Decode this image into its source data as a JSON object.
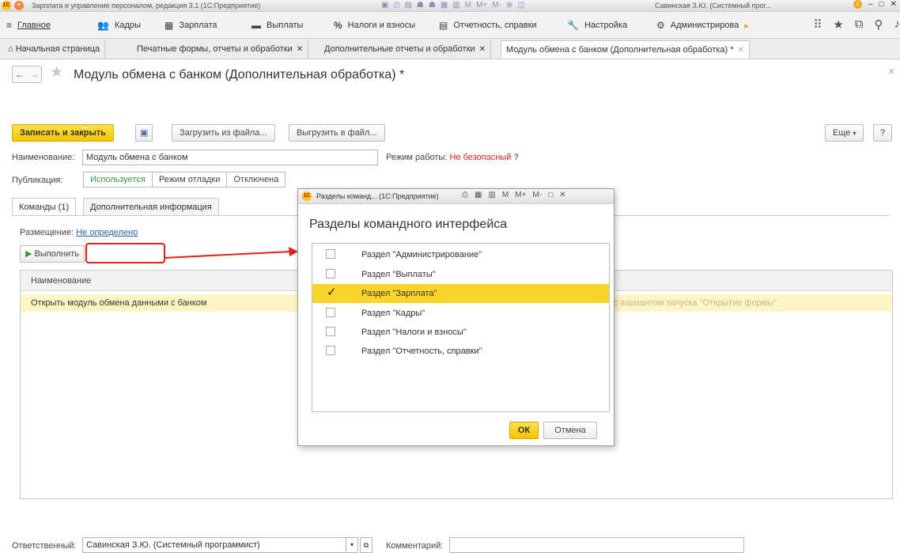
{
  "app": {
    "window_title": "Зарплата и управление персоналом, редакция 3.1  (1С:Предприятие)",
    "user": "Савинская З.Ю. (Системный прог...",
    "logo_text": "1С"
  },
  "main_menu": [
    {
      "label": "Главное",
      "icon": "≡"
    },
    {
      "label": "Кадры",
      "icon": "👥"
    },
    {
      "label": "Зарплата",
      "icon": "▦"
    },
    {
      "label": "Выплаты",
      "icon": "▬"
    },
    {
      "label": "Налоги и взносы",
      "icon": "%"
    },
    {
      "label": "Отчетность, справки",
      "icon": "▤"
    },
    {
      "label": "Настройка",
      "icon": "🔧"
    },
    {
      "label": "Администрирова",
      "icon": "⚙"
    }
  ],
  "tabs": [
    {
      "label": "Начальная страница"
    },
    {
      "label": "Печатные формы, отчеты и обработки"
    },
    {
      "label": "Дополнительные отчеты и обработки"
    },
    {
      "label": "Модуль обмена с банком (Дополнительная обработка) *"
    }
  ],
  "form": {
    "title": "Модуль обмена с банком (Дополнительная обработка) *",
    "toolbar": {
      "save_close": "Записать и закрыть",
      "load_file": "Загрузить из файла...",
      "export_file": "Выгрузить в файл...",
      "more": "Еще",
      "help": "?"
    },
    "name_label": "Наименование:",
    "name_value": "Модуль обмена с банком",
    "mode_label": "Режим работы:",
    "mode_value": "Не безопасный",
    "mode_help": "?",
    "publication_label": "Публикация:",
    "publication_options": [
      "Используется",
      "Режим отладки",
      "Отключена"
    ],
    "inner_tabs": [
      "Команды (1)",
      "Дополнительная информация"
    ],
    "placement_label": "Размещение:",
    "placement_value": "Не определено",
    "execute_label": "Выполнить",
    "table_header": "Наименование",
    "row_name": "Открыть модуль обмена данными с банком",
    "row_extra": "с вариантом запуска \"Открытие формы\"",
    "responsible_label": "Ответственный:",
    "responsible_value": "Савинская З.Ю. (Системный программист)",
    "comment_label": "Комментарий:",
    "comment_value": ""
  },
  "modal": {
    "window_title": "Разделы команд...  (1С:Предприятие)",
    "title_tools": [
      "M",
      "M+",
      "M-"
    ],
    "heading": "Разделы командного интерфейса",
    "items": [
      {
        "label": "Раздел \"Администрирование\"",
        "checked": false
      },
      {
        "label": "Раздел \"Выплаты\"",
        "checked": false
      },
      {
        "label": "Раздел \"Зарплата\"",
        "checked": true
      },
      {
        "label": "Раздел \"Кадры\"",
        "checked": false
      },
      {
        "label": "Раздел \"Налоги и взносы\"",
        "checked": false
      },
      {
        "label": "Раздел \"Отчетность, справки\"",
        "checked": false
      }
    ],
    "ok": "ОК",
    "cancel": "Отмена"
  },
  "colors": {
    "accent_yellow": "#f5c400",
    "selected_row": "#f9d52a",
    "annotation_red": "#e0201a",
    "warning_red": "#d0221e",
    "link_blue": "#2a5fa8"
  }
}
